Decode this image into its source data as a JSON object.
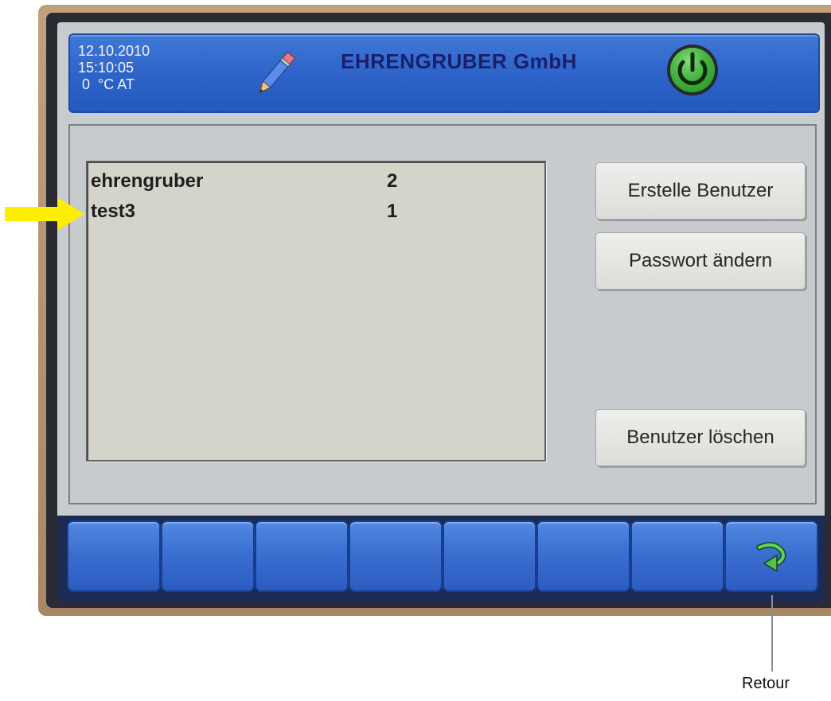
{
  "header": {
    "date": "12.10.2010",
    "time": "15:10:05",
    "temperature": " 0  °C AT",
    "company": "EHRENGRUBER GmbH",
    "icons": [
      "pencil-icon",
      "power-icon"
    ]
  },
  "users": [
    {
      "name": "ehrengruber",
      "level": "2"
    },
    {
      "name": "test3",
      "level": "1"
    }
  ],
  "buttons": {
    "create_user": "Erstelle Benutzer",
    "change_password": "Passwort ändern",
    "delete_user": "Benutzer löschen"
  },
  "function_keys": {
    "count": 8,
    "last_icon": "back-arrow-icon"
  },
  "annotations": {
    "retour": "Retour"
  },
  "colors": {
    "header_blue": "#2d62c8",
    "company_text": "#1a1f6b",
    "power_green": "#3dbb3a",
    "arrow_yellow": "#ffee00"
  }
}
